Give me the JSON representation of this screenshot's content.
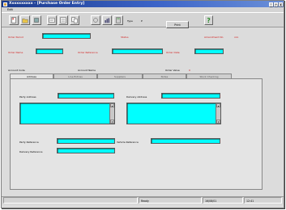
{
  "window": {
    "title": "Xxxxxxxxxx - [Purchase Order Entry]",
    "controls": [
      "_",
      "□",
      "X"
    ]
  },
  "menubar": {
    "items": [
      "Edit"
    ]
  },
  "toolbar": {
    "type_label": "Type",
    "type_value": "P",
    "print_label": "Print",
    "help_label": "?"
  },
  "header": {
    "order_period_label": "Order Period",
    "status_label": "Status",
    "amendment_label": "Amendment No",
    "amendment_value": "xxx",
    "order_name_label": "Order Name",
    "order_reference_label": "Order Reference",
    "order_date_label": "Order Date",
    "account_code_label": "Account Code",
    "account_name_label": "Account Name",
    "order_value_label": "Order Value",
    "order_value": "0"
  },
  "tabs": [
    "Address",
    "Line Entries",
    "Suppliers",
    "Notes",
    "Stock Checking"
  ],
  "address_tab": {
    "party_address_label": "Party Address",
    "delivery_address_label": "Delivery Address",
    "party_reference_label": "Party Reference",
    "vehicle_reference_label": "Vehicle Reference",
    "delivery_reference_label": "Delivery Reference"
  },
  "statusbar": {
    "state": "Ready",
    "date": "16/08/01",
    "time": "12:41"
  },
  "colors": {
    "field": "#00ffff",
    "label_red": "#d21919",
    "titlebar": "#1b3a8c"
  }
}
